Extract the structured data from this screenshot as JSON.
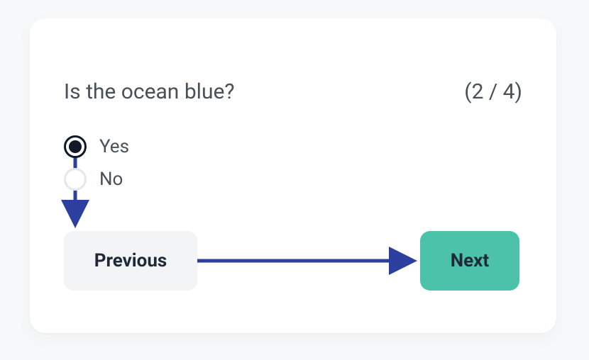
{
  "question": "Is the ocean blue?",
  "counter": "(2 / 4)",
  "step_current": 2,
  "step_total": 4,
  "options": [
    {
      "label": "Yes",
      "selected": true
    },
    {
      "label": "No",
      "selected": false
    }
  ],
  "buttons": {
    "previous": "Previous",
    "next": "Next"
  },
  "arrow_color": "#2c3e9e"
}
